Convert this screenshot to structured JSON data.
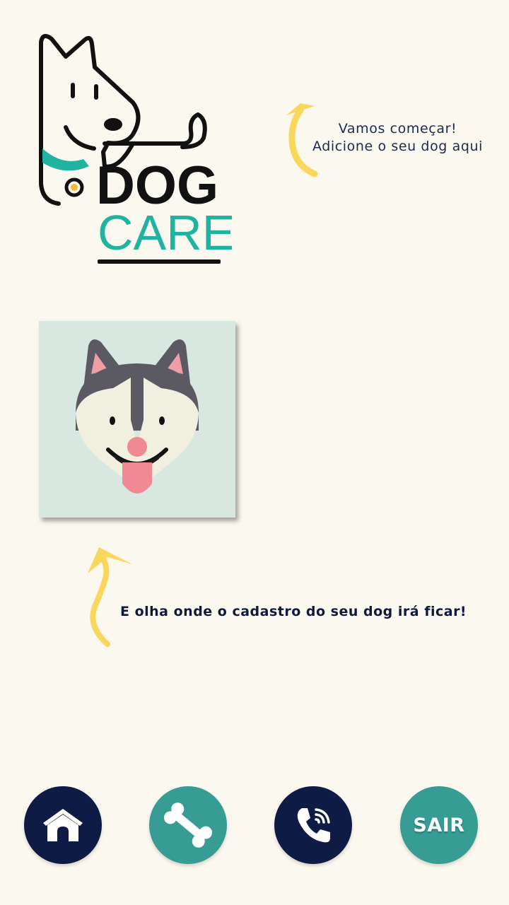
{
  "logo": {
    "line1": "DOG",
    "line2": "CARE"
  },
  "hints": {
    "top_line1": "Vamos começar!",
    "top_line2": "Adicione o seu dog aqui",
    "bottom": "E olha onde o cadastro do seu dog irá ficar!"
  },
  "dog_card": {
    "icon": "husky-face-icon"
  },
  "nav": {
    "home_icon": "doghouse-icon",
    "bone_icon": "bone-icon",
    "phone_icon": "phone-icon",
    "exit_label": "SAIR"
  },
  "colors": {
    "background": "#fbf8ef",
    "navy": "#0d1b45",
    "teal": "#379c94",
    "arrow_yellow": "#f9d65c",
    "logo_teal": "#1fb3a0"
  }
}
